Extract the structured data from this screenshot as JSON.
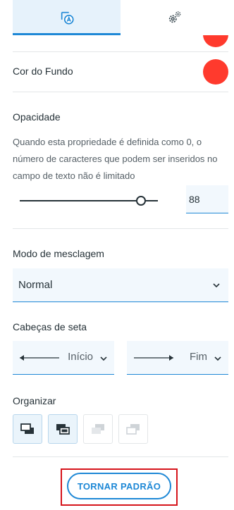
{
  "tabs": [
    {
      "icon": "format-shape-text-icon",
      "active": true
    },
    {
      "icon": "gears-icon",
      "active": false
    }
  ],
  "background_color": {
    "label": "Cor do Fundo",
    "value": "#ff3a2d"
  },
  "opacity": {
    "title": "Opacidade",
    "description": "Quando esta propriedade é definida como 0, o número de caracteres que podem ser inseridos no campo de texto não é limitado",
    "value": "88"
  },
  "blend_mode": {
    "title": "Modo de mesclagem",
    "selected": "Normal"
  },
  "arrowheads": {
    "title": "Cabeças de seta",
    "start_label": "Início",
    "end_label": "Fim"
  },
  "arrange": {
    "title": "Organizar"
  },
  "default_button": {
    "label": "TORNAR PADRÃO"
  },
  "colors": {
    "accent": "#1e88d6",
    "swatch": "#ff3a2d",
    "highlight": "#d6141b"
  }
}
